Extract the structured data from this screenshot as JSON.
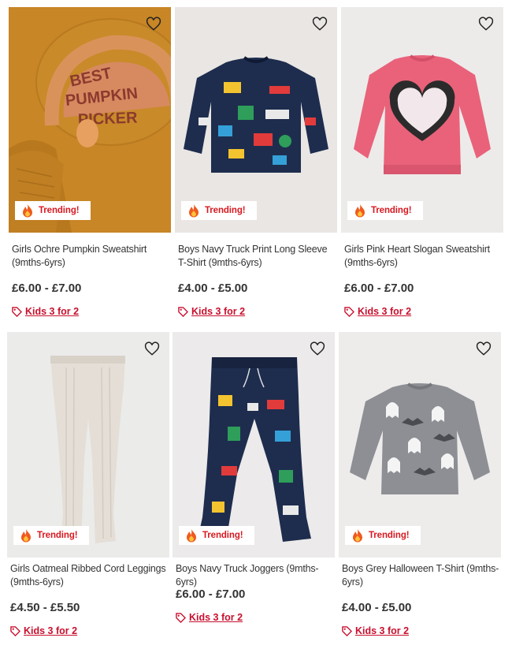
{
  "products": [
    {
      "name": "Girls Ochre Pumpkin Sweatshirt (9mths-6yrs)",
      "price": "£6.00 - £7.00",
      "badge": "Trending!",
      "promo": "Kids 3 for 2",
      "image_bg": "#c98a2a",
      "wishlist_icon": "heart-outline-icon",
      "print_text": "BEST PUMPKIN PICKER"
    },
    {
      "name": "Boys Navy Truck Print Long Sleeve T-Shirt (9mths-6yrs)",
      "price": "£4.00 - £5.00",
      "badge": "Trending!",
      "promo": "Kids 3 for 2",
      "image_bg": "#e9e6e4",
      "wishlist_icon": "heart-outline-icon"
    },
    {
      "name": "Girls Pink Heart Slogan Sweatshirt (9mths-6yrs)",
      "price": "£6.00 - £7.00",
      "badge": "Trending!",
      "promo": "Kids 3 for 2",
      "image_bg": "#ecebea",
      "wishlist_icon": "heart-outline-icon"
    },
    {
      "name": "Girls Oatmeal Ribbed Cord Leggings (9mths-6yrs)",
      "price": "£4.50 - £5.50",
      "badge": "Trending!",
      "promo": "Kids 3 for 2",
      "image_bg": "#ebebea",
      "wishlist_icon": "heart-outline-icon"
    },
    {
      "name": "Boys Navy Truck Joggers (9mths-6yrs)",
      "price": "£6.00 - £7.00",
      "badge": "Trending!",
      "promo": "Kids 3 for 2",
      "image_bg": "#eceaea",
      "wishlist_icon": "heart-outline-icon"
    },
    {
      "name": "Boys Grey Halloween T-Shirt (9mths-6yrs)",
      "price": "£4.00 - £5.00",
      "badge": "Trending!",
      "promo": "Kids 3 for 2",
      "image_bg": "#edeceb",
      "wishlist_icon": "heart-outline-icon"
    }
  ],
  "colors": {
    "promo": "#c8102e",
    "badge_text": "#d71920",
    "price": "#333333"
  }
}
